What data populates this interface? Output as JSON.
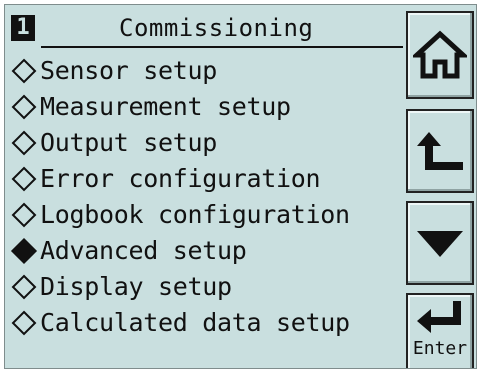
{
  "header": {
    "page_number": "1",
    "title": "Commissioning"
  },
  "menu": {
    "items": [
      {
        "label": "Sensor setup",
        "selected": false
      },
      {
        "label": "Measurement setup",
        "selected": false
      },
      {
        "label": "Output setup",
        "selected": false
      },
      {
        "label": "Error configuration",
        "selected": false
      },
      {
        "label": "Logbook configuration",
        "selected": false
      },
      {
        "label": "Advanced setup",
        "selected": true
      },
      {
        "label": "Display setup",
        "selected": false
      },
      {
        "label": "Calculated data setup",
        "selected": false
      }
    ]
  },
  "buttons": {
    "home_icon": "home-icon",
    "back_icon": "back-arrow-icon",
    "down_icon": "down-triangle-icon",
    "enter_icon": "enter-return-icon",
    "enter_label": "Enter"
  },
  "colors": {
    "screen_background": "#c9dfdf",
    "foreground": "#111111"
  }
}
